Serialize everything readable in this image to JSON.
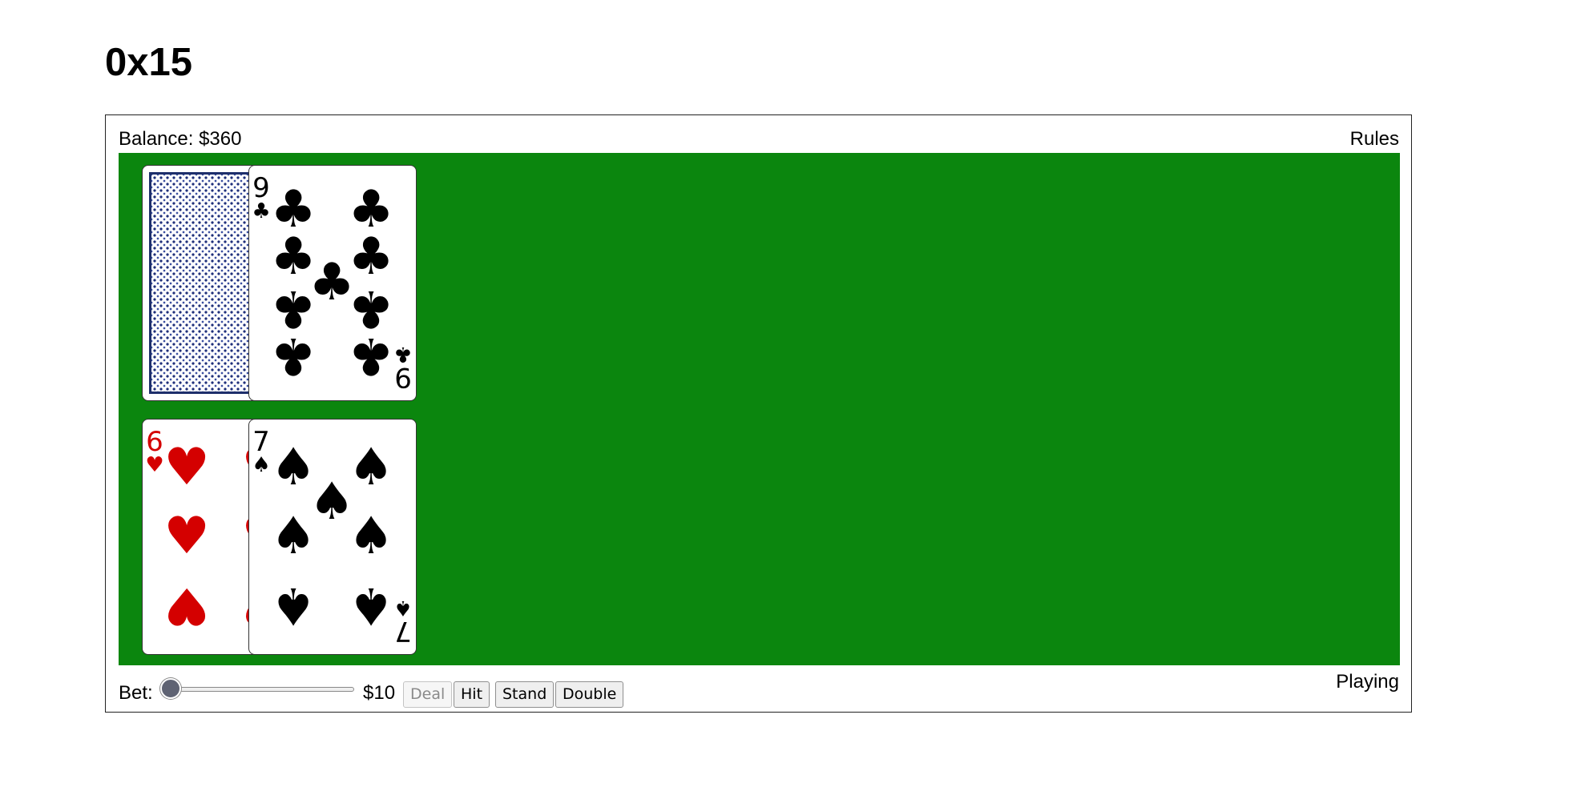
{
  "page": {
    "title": "0x15"
  },
  "header": {
    "balance_label": "Balance: $360",
    "rules_link": "Rules"
  },
  "dealer": {
    "cards": [
      {
        "face_down": true
      },
      {
        "face_down": false,
        "rank": "9",
        "suit": "clubs",
        "suit_symbol": "♣",
        "color": "#000000"
      }
    ]
  },
  "player": {
    "cards": [
      {
        "face_down": false,
        "rank": "6",
        "suit": "hearts",
        "suit_symbol": "♥",
        "color": "#d40000"
      },
      {
        "face_down": false,
        "rank": "7",
        "suit": "spades",
        "suit_symbol": "♠",
        "color": "#000000"
      }
    ]
  },
  "controls": {
    "bet_label": "Bet:",
    "bet_amount": "$10",
    "bet_slider_position": 0,
    "deal_label": "Deal",
    "deal_disabled": true,
    "hit_label": "Hit",
    "stand_label": "Stand",
    "double_label": "Double"
  },
  "status": "Playing",
  "colors": {
    "felt": "#0b860e",
    "card_back": "#1e2f6b",
    "red_suit": "#d40000"
  }
}
